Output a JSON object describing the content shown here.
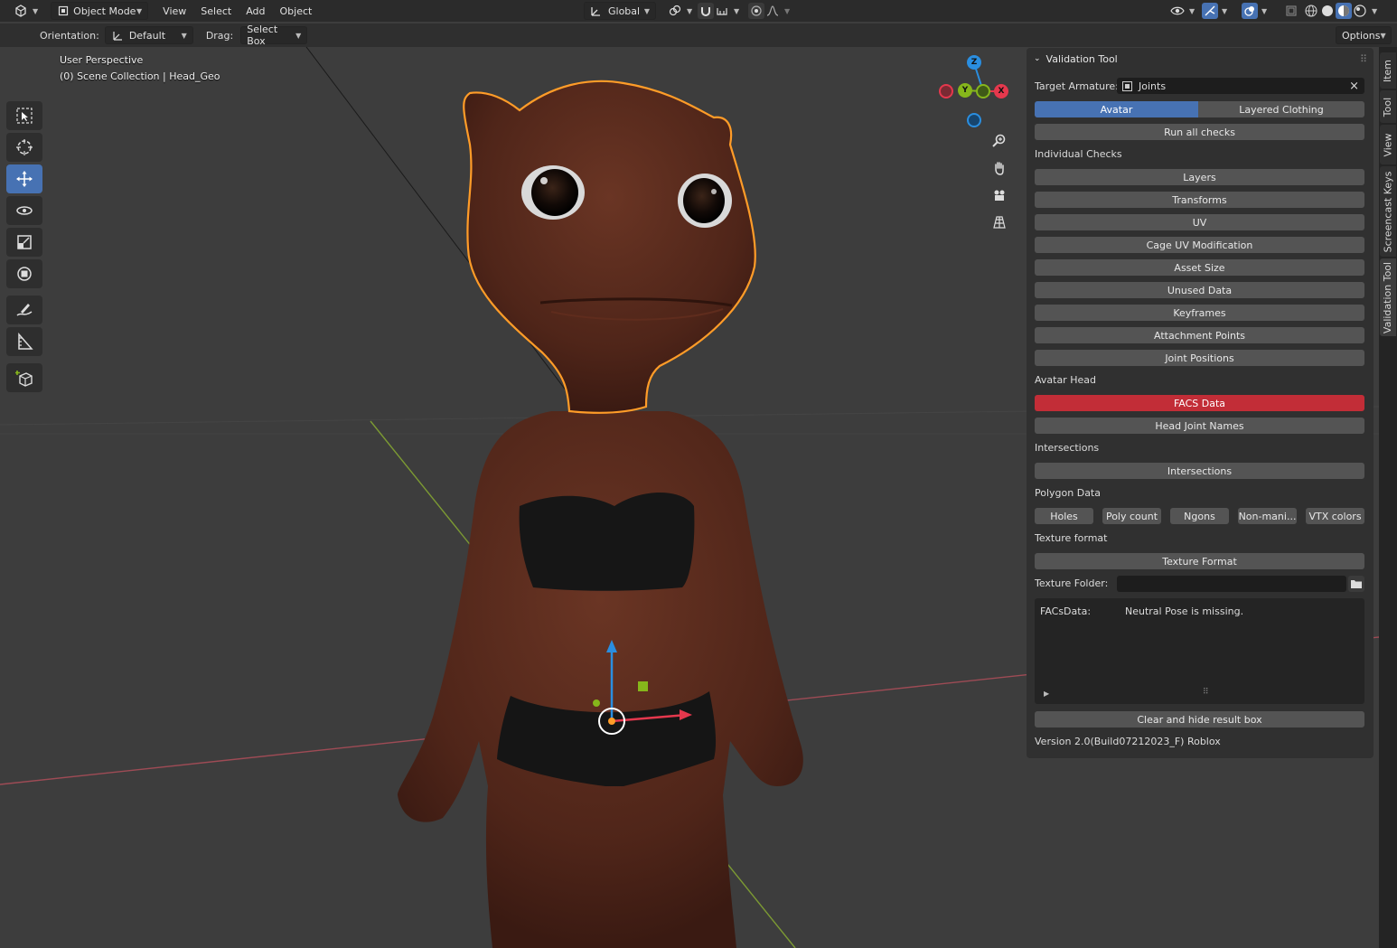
{
  "header": {
    "mode": "Object Mode",
    "menus": [
      "View",
      "Select",
      "Add",
      "Object"
    ],
    "transform_orientation": "Global"
  },
  "tool_settings": {
    "orientation_label": "Orientation:",
    "orientation_value": "Default",
    "drag_label": "Drag:",
    "drag_value": "Select Box",
    "options_label": "Options"
  },
  "viewport": {
    "perspective": "User Perspective",
    "collection": "(0) Scene Collection | Head_Geo"
  },
  "gizmo": {
    "z": "Z",
    "y": "Y",
    "x": "X"
  },
  "panel": {
    "title": "Validation Tool",
    "target_armature_label": "Target Armature:",
    "target_armature_value": "Joints",
    "tabs": [
      "Avatar",
      "Layered Clothing"
    ],
    "run_all": "Run all checks",
    "individual_checks_label": "Individual Checks",
    "individual_checks": [
      "Layers",
      "Transforms",
      "UV",
      "Cage UV Modification",
      "Asset Size",
      "Unused Data",
      "Keyframes",
      "Attachment Points",
      "Joint Positions"
    ],
    "avatar_head_label": "Avatar Head",
    "facs_data": "FACS Data",
    "head_joint_names": "Head Joint Names",
    "intersections_label": "Intersections",
    "intersections_button": "Intersections",
    "polygon_data_label": "Polygon Data",
    "polygon_buttons": [
      "Holes",
      "Poly count",
      "Ngons",
      "Non-mani...",
      "VTX colors"
    ],
    "texture_format_label": "Texture format",
    "texture_format_button": "Texture Format",
    "texture_folder_label": "Texture Folder:",
    "texture_folder_value": "",
    "result_key": "FACsData:",
    "result_value": "Neutral Pose is missing.",
    "clear_button": "Clear and hide result box",
    "version": "Version 2.0(Build07212023_F) Roblox"
  },
  "side_tabs": [
    "Item",
    "Tool",
    "View",
    "Screencast Keys",
    "Validation Tool"
  ],
  "colors": {
    "accent": "#4772b3",
    "error": "#c22d37",
    "selection_outline": "#ff9c28",
    "axis_x": "#e5384d",
    "axis_y": "#86b61b",
    "axis_z": "#2a8ee0"
  }
}
